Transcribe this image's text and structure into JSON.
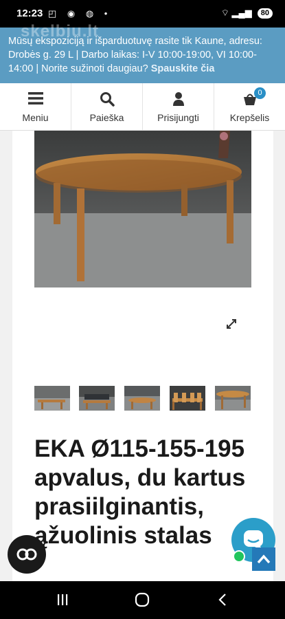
{
  "status": {
    "time": "12:23",
    "icons": "◰ ◉ ◍ •",
    "signal": "⌔ ▂▄▆",
    "battery": "80"
  },
  "banner": {
    "watermark": "skelbiu.lt",
    "text": "Mūsų ekspoziciją ir išparduotuvę rasite tik Kaune, adresu: Drobės g. 29 L | Darbo laikas: I-V 10:00-19:00, VI 10:00-14:00 | Norite sužinoti daugiau?",
    "link": "Spauskite čia"
  },
  "nav": {
    "menu": "Meniu",
    "search": "Paieška",
    "login": "Prisijungti",
    "cart": "Krepšelis",
    "cart_count": "0"
  },
  "product": {
    "title": "EKA Ø115-155-195 apvalus, du kartus prasiilginantis, ąžuolinis stalas"
  },
  "colors": {
    "banner": "#5b9cc2",
    "accent": "#2a8fc6",
    "chat": "#2b9ec9"
  }
}
